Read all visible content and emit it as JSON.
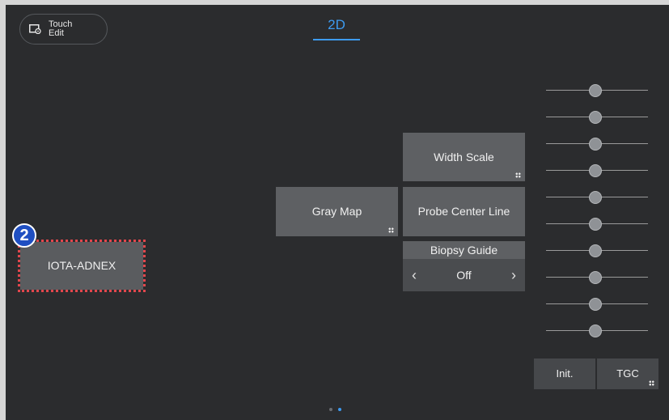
{
  "header": {
    "touch_edit": {
      "line1": "Touch",
      "line2": "Edit",
      "icon": "touch-edit-icon"
    },
    "mode_tab": "2D"
  },
  "buttons": {
    "width_scale": "Width Scale",
    "gray_map": "Gray Map",
    "probe_center_line": "Probe Center Line",
    "iota_adnex": "IOTA-ADNEX"
  },
  "biopsy_guide": {
    "label": "Biopsy Guide",
    "value": "Off",
    "prev_icon": "chevron-left-icon",
    "next_icon": "chevron-right-icon"
  },
  "callout": {
    "number": "2"
  },
  "tgc_panel": {
    "slider_count": 10,
    "init_label": "Init.",
    "tgc_label": "TGC"
  },
  "pagination": {
    "pages": 2,
    "current": 2
  },
  "colors": {
    "background": "#2b2c2e",
    "button": "#5e6063",
    "accent": "#3d9bf0",
    "highlight_outline": "#e2474d",
    "badge": "#1f4fc2"
  }
}
